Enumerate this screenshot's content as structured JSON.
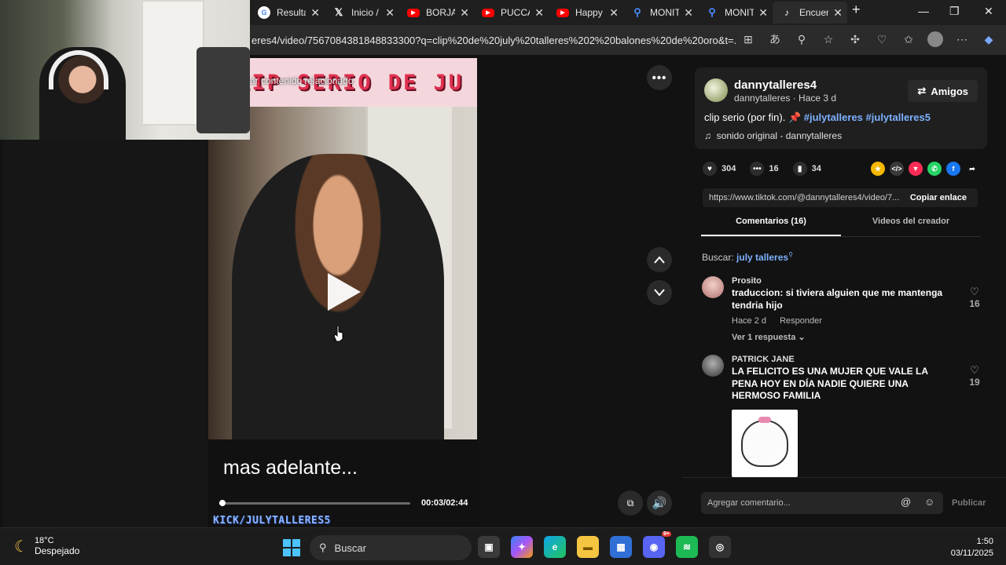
{
  "browser": {
    "tabs": [
      {
        "label": "Resulta",
        "icon": "google-icon",
        "color": "#ffffff",
        "active": false
      },
      {
        "label": "Inicio /",
        "icon": "x-icon",
        "color": "#000000",
        "active": false
      },
      {
        "label": "BORJA",
        "icon": "youtube-icon",
        "color": "#ff0000",
        "active": false
      },
      {
        "label": "PUCCA",
        "icon": "youtube-icon",
        "color": "#ff0000",
        "active": false
      },
      {
        "label": "Happy",
        "icon": "youtube-icon",
        "color": "#ff0000",
        "active": false
      },
      {
        "label": "MONIT",
        "icon": "search-icon",
        "color": "#2d6cdf",
        "active": false
      },
      {
        "label": "MONIT",
        "icon": "search-icon",
        "color": "#2d6cdf",
        "active": false
      },
      {
        "label": "Encuen",
        "icon": "tiktok-icon",
        "color": "#000000",
        "active": true
      }
    ],
    "url": "eres4/video/7567084381848833300?q=clip%20de%20july%20talleres%202%20balones%20de%20oro&t=..."
  },
  "video": {
    "banner_title": "CLIP SERIO DE JU",
    "related_overlay": "ar contenido relacionado",
    "caption": "mas adelante...",
    "current_time": "00:03",
    "duration": "02:44",
    "time_display": "00:03/02:44",
    "progress": 0.018,
    "watermark": "KICK/JULYTALLERES5"
  },
  "post": {
    "author": "dannytalleres4",
    "author_sub": "dannytalleres · Hace 3 d",
    "friends_label": "Amigos",
    "description": "clip serio (por fin).",
    "hashtags": [
      "#julytalleres",
      "#julytalleres5"
    ],
    "sound": "sonido original - dannytalleres",
    "likes": "304",
    "comments": "16",
    "saves": "34",
    "link": "https://www.tiktok.com/@dannytalleres4/video/7...",
    "copy_label": "Copiar enlace"
  },
  "panel_tabs": {
    "comments": "Comentarios (16)",
    "creator": "Videos del creador"
  },
  "search": {
    "prefix": "Buscar:",
    "query": "july talleres"
  },
  "comments": [
    {
      "name": "Prosito",
      "text": "traduccion: si tiviera alguien que me mantenga tendria hijo",
      "time": "Hace 2 d",
      "reply_label": "Responder",
      "replies": "Ver 1 respuesta",
      "likes": "16"
    },
    {
      "name": "PATRICK JANE",
      "text": "LA FELICITO ES UNA MUJER QUE VALE LA PENA HOY EN DÍA NADIE QUIERE UNA HERMOSO FAMILIA",
      "likes": "19"
    }
  ],
  "comment_input": {
    "placeholder": "Agregar comentario...",
    "publish_label": "Publicar"
  },
  "taskbar": {
    "temperature": "18°C",
    "weather": "Despejado",
    "search_label": "Buscar",
    "time": "1:50",
    "date": "03/11/2025",
    "discord_badge": "9+"
  }
}
